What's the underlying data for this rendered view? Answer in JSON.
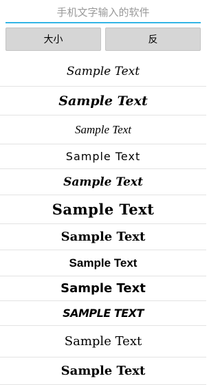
{
  "search": {
    "placeholder": "手机文字输入的软件",
    "value": ""
  },
  "buttons": {
    "size": "大小",
    "reverse": "反"
  },
  "samples": [
    "Sample Text",
    "Sample Text",
    "Sample Text",
    "Sample Text",
    "Sample Text",
    "Sample Text",
    "Sample Text",
    "Sample Text",
    "Sample Text",
    "SAMPLE TEXT",
    "Sample Text",
    "Sample Text"
  ]
}
